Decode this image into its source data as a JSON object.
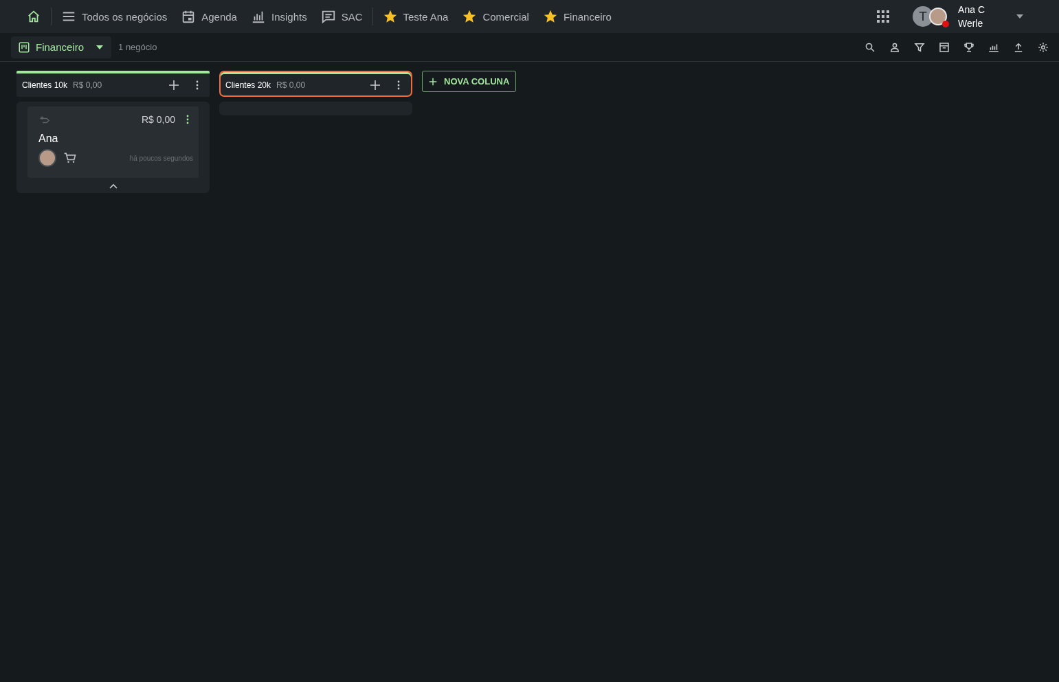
{
  "nav": [
    {
      "kind": "home",
      "selected": true
    },
    {
      "kind": "divider"
    },
    {
      "kind": "list",
      "label": "Todos os negócios",
      "selected": false
    },
    {
      "kind": "calendar",
      "label": "Agenda",
      "selected": false
    },
    {
      "kind": "chart",
      "label": "Insights",
      "selected": false
    },
    {
      "kind": "chat",
      "label": "SAC",
      "selected": false
    },
    {
      "kind": "divider"
    },
    {
      "kind": "star",
      "label": "Teste Ana",
      "selected": false
    },
    {
      "kind": "star",
      "label": "Comercial",
      "selected": false
    },
    {
      "kind": "star",
      "label": "Financeiro",
      "selected": false
    }
  ],
  "user": {
    "initial": "T",
    "name_line1": "Ana C",
    "name_line2": "Werle"
  },
  "pipeline": {
    "name": "Financeiro",
    "count": "1 negócio"
  },
  "columns": [
    {
      "title": "Clientes 10k",
      "total": "R$ 0,00",
      "selected": false,
      "expanded": true,
      "cards": [
        {
          "value": "R$ 0,00",
          "name": "Ana",
          "time": "há poucos segundos"
        }
      ]
    },
    {
      "title": "Clientes 20k",
      "total": "R$ 0,00",
      "selected": true,
      "expanded": false
    }
  ],
  "add_column": "NOVA COLUNA"
}
